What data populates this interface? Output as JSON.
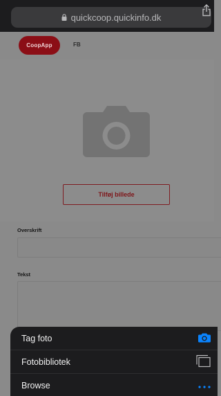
{
  "browser": {
    "url": "quickcoop.quickinfo.dk",
    "icons": {
      "lock": "lock-icon",
      "share": "share-icon"
    }
  },
  "header": {
    "logo_text": "CoopApp",
    "fb_link": "FB"
  },
  "photo": {
    "placeholder_icon": "camera-icon",
    "add_button": "Tilføj billede"
  },
  "form": {
    "headline_label": "Overskrift",
    "headline_value": "",
    "text_label": "Tekst",
    "text_value": ""
  },
  "action_sheet": {
    "items": [
      {
        "label": "Tag foto",
        "icon": "camera-icon"
      },
      {
        "label": "Fotobibliotek",
        "icon": "photo-library-icon"
      },
      {
        "label": "Browse",
        "icon": "more-icon"
      }
    ]
  },
  "colors": {
    "brand_red": "#8b0e16",
    "ios_blue": "#0a84ff",
    "sheet_bg": "#1c1c1e"
  }
}
